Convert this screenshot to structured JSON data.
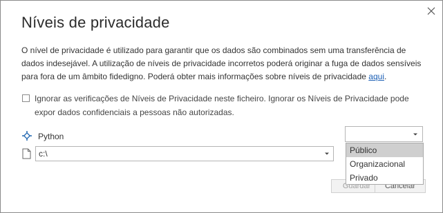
{
  "dialog": {
    "title": "Níveis de privacidade",
    "close_icon": "close-icon",
    "description": "O nível de privacidade é utilizado para garantir que os dados são combinados sem uma transferência de dados indesejável. A utilização de níveis de privacidade incorretos poderá originar a fuga de dados sensíveis para fora de um âmbito fidedigno. Poderá obter mais informações sobre níveis de privacidade",
    "description_link": "aqui",
    "description_end": ".",
    "ignore_checkbox": {
      "checked": false,
      "label": "Ignorar as verificações de Níveis de Privacidade neste ficheiro. Ignorar os Níveis de Privacidade pode expor dados confidenciais a pessoas não autorizadas."
    }
  },
  "source": {
    "name": "Python",
    "icon": "python-icon",
    "path_value": "c:\\",
    "path_icon": "file-icon"
  },
  "privacy_level": {
    "selected": "",
    "options": [
      "Público",
      "Organizacional",
      "Privado"
    ],
    "highlighted_index": 0
  },
  "buttons": {
    "save": "Guardar",
    "cancel": "Cancelar"
  },
  "colors": {
    "link": "#1b5fb5",
    "highlight": "#cfcfcf",
    "border": "#8a8a8a"
  }
}
